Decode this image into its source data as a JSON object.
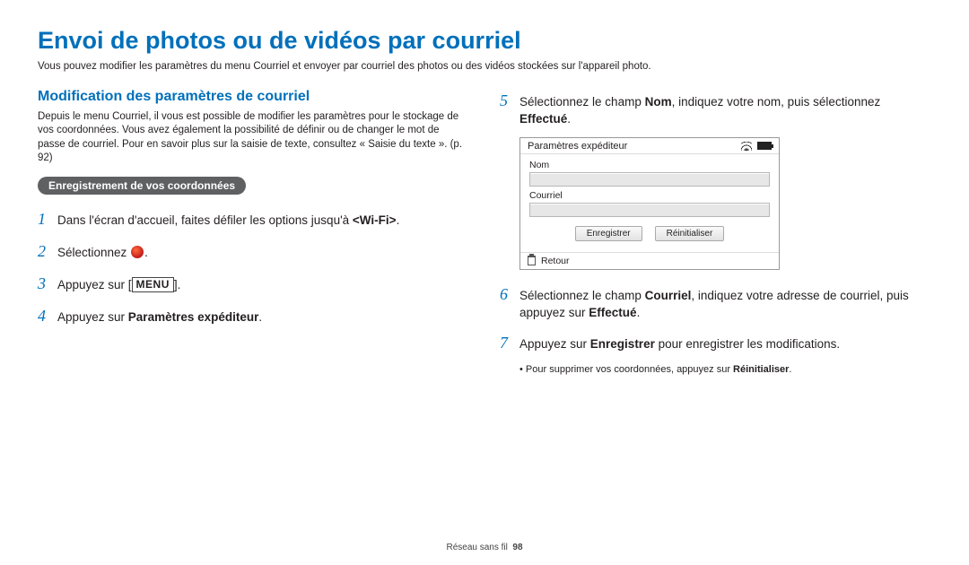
{
  "title": "Envoi de photos ou de vidéos par courriel",
  "intro": "Vous pouvez modifier les paramètres du menu Courriel et envoyer par courriel des photos ou des vidéos stockées sur l'appareil photo.",
  "section": {
    "title": "Modification des paramètres de courriel",
    "intro": "Depuis le menu Courriel, il vous est possible de modifier les paramètres pour le stockage de vos coordonnées. Vous avez également la possibilité de définir ou de changer le mot de passe de courriel. Pour en savoir plus sur la saisie de texte, consultez « Saisie du texte ». (p. 92)",
    "pill": "Enregistrement de vos coordonnées"
  },
  "steps_left": {
    "s1_pre": "Dans l'écran d'accueil, faites défiler les options jusqu'à ",
    "s1_bold": "<Wi-Fi>",
    "s1_post": ".",
    "s2": "Sélectionnez ",
    "s2_post": ".",
    "s3_pre": "Appuyez sur [",
    "s3_chip": "MENU",
    "s3_post": "].",
    "s4_pre": "Appuyez sur ",
    "s4_bold": "Paramètres expéditeur",
    "s4_post": "."
  },
  "steps_right": {
    "s5_pre": "Sélectionnez le champ ",
    "s5_b1": "Nom",
    "s5_mid": ", indiquez votre nom, puis sélectionnez ",
    "s5_b2": "Effectué",
    "s5_post": ".",
    "s6_pre": "Sélectionnez le champ ",
    "s6_b1": "Courriel",
    "s6_mid": ", indiquez votre adresse de courriel, puis appuyez sur ",
    "s6_b2": "Effectué",
    "s6_post": ".",
    "s7_pre": "Appuyez sur ",
    "s7_b1": "Enregistrer",
    "s7_post": " pour enregistrer les modifications.",
    "bullet_pre": "Pour supprimer vos coordonnées, appuyez sur ",
    "bullet_b": "Réinitialiser",
    "bullet_post": "."
  },
  "device": {
    "header": "Paramètres expéditeur",
    "label_name": "Nom",
    "label_mail": "Courriel",
    "btn_save": "Enregistrer",
    "btn_reset": "Réinitialiser",
    "footer": "Retour"
  },
  "footer": {
    "section": "Réseau sans fil",
    "page": "98"
  }
}
